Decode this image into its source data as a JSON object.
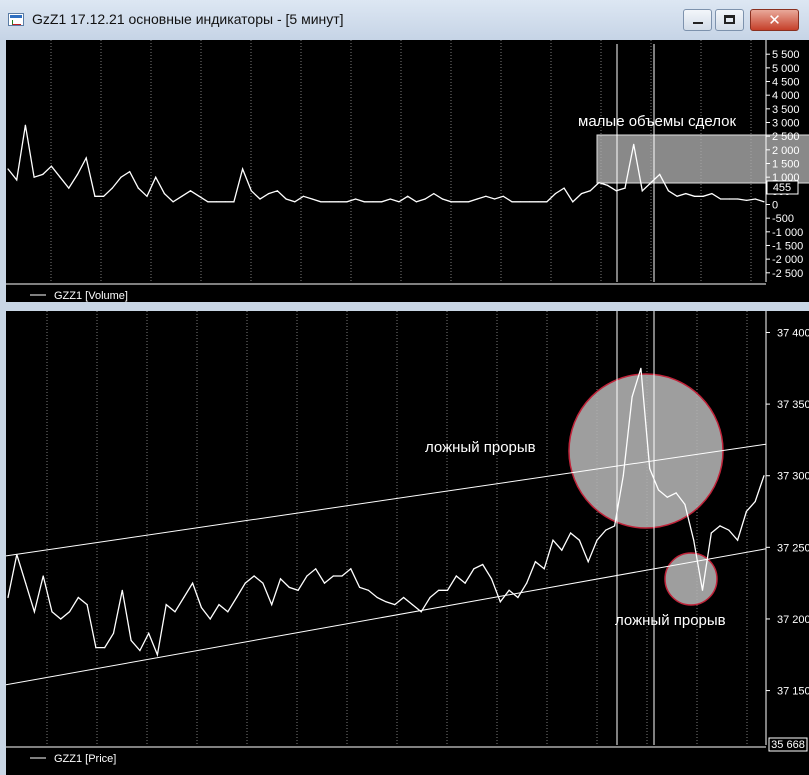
{
  "window": {
    "title": "GzZ1 17.12.21 основные индикаторы - [5 минут]",
    "close_glyph": "✕"
  },
  "volume_pane": {
    "legend": "GZZ1 [Volume]",
    "current_value_label": "455",
    "annotation": "малые объемы сделок",
    "line_color": "#ffffff",
    "highlight_fill": "#b0b0b0"
  },
  "price_pane": {
    "legend": "GZZ1 [Price]",
    "current_value_label": "35 668",
    "annotation_upper": "ложный прорыв",
    "annotation_lower": "ложный прорыв",
    "circle_stroke": "#c0243a",
    "circle_fill": "#b4b4b4"
  },
  "chart_data": [
    {
      "type": "line",
      "name": "volume",
      "y_ticks": [
        "5 500",
        "5 000",
        "4 500",
        "4 000",
        "3 500",
        "3 000",
        "2 500",
        "2 000",
        "1 500",
        "1 000",
        "500",
        "0",
        "-500",
        "-1 000",
        "-1 500",
        "-2 000",
        "-2 500"
      ],
      "y_tick_values": [
        5500,
        5000,
        4500,
        4000,
        3500,
        3000,
        2500,
        2000,
        1500,
        1000,
        500,
        0,
        -500,
        -1000,
        -1500,
        -2000,
        -2500
      ],
      "ylim": [
        -2800,
        5800
      ],
      "values": [
        1300,
        900,
        2900,
        1000,
        1100,
        1400,
        1000,
        600,
        1100,
        1700,
        300,
        300,
        600,
        1000,
        1200,
        600,
        300,
        1000,
        400,
        100,
        300,
        500,
        300,
        100,
        100,
        100,
        100,
        1300,
        500,
        200,
        400,
        500,
        200,
        100,
        300,
        200,
        100,
        100,
        100,
        100,
        200,
        100,
        100,
        100,
        200,
        100,
        300,
        100,
        200,
        400,
        200,
        100,
        100,
        100,
        200,
        300,
        200,
        300,
        100,
        100,
        100,
        100,
        100,
        400,
        600,
        100,
        400,
        500,
        800,
        700,
        500,
        600,
        2200,
        500,
        800,
        1100,
        500,
        300,
        400,
        300,
        300,
        400,
        200,
        200,
        200,
        150,
        200,
        100
      ]
    },
    {
      "type": "line",
      "name": "price",
      "y_ticks": [
        "37 400",
        "37 350",
        "37 300",
        "37 250",
        "37 200",
        "37 150"
      ],
      "y_tick_values": [
        37400,
        37350,
        37300,
        37250,
        37200,
        37150
      ],
      "ylim": [
        37112,
        37415
      ],
      "values": [
        37215,
        37245,
        37225,
        37205,
        37230,
        37205,
        37200,
        37205,
        37215,
        37210,
        37180,
        37180,
        37190,
        37220,
        37185,
        37178,
        37190,
        37175,
        37210,
        37205,
        37215,
        37225,
        37208,
        37200,
        37210,
        37205,
        37215,
        37225,
        37230,
        37225,
        37210,
        37228,
        37222,
        37220,
        37230,
        37235,
        37225,
        37230,
        37230,
        37235,
        37222,
        37220,
        37215,
        37212,
        37210,
        37215,
        37210,
        37205,
        37215,
        37220,
        37220,
        37230,
        37225,
        37235,
        37238,
        37228,
        37212,
        37220,
        37215,
        37225,
        37240,
        37235,
        37255,
        37248,
        37260,
        37255,
        37240,
        37255,
        37262,
        37265,
        37300,
        37355,
        37375,
        37305,
        37290,
        37285,
        37288,
        37280,
        37255,
        37220,
        37260,
        37265,
        37262,
        37255,
        37275,
        37282,
        37300
      ],
      "channel_upper": [
        [
          0,
          37244
        ],
        [
          1,
          37322
        ]
      ],
      "channel_lower": [
        [
          0,
          37154
        ],
        [
          1,
          37249
        ]
      ]
    }
  ]
}
